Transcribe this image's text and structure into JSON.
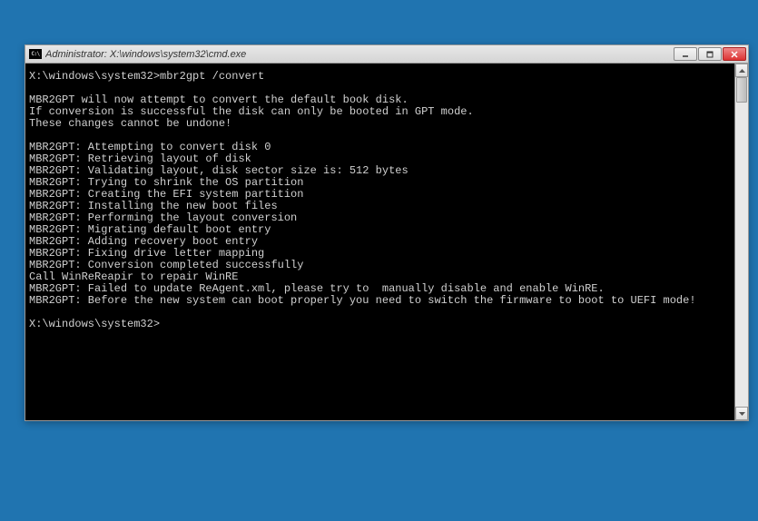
{
  "window": {
    "icon_text": "C:\\",
    "title": "Administrator: X:\\windows\\system32\\cmd.exe"
  },
  "terminal": {
    "lines": [
      "X:\\windows\\system32>mbr2gpt /convert",
      "",
      "MBR2GPT will now attempt to convert the default book disk.",
      "If conversion is successful the disk can only be booted in GPT mode.",
      "These changes cannot be undone!",
      "",
      "MBR2GPT: Attempting to convert disk 0",
      "MBR2GPT: Retrieving layout of disk",
      "MBR2GPT: Validating layout, disk sector size is: 512 bytes",
      "MBR2GPT: Trying to shrink the OS partition",
      "MBR2GPT: Creating the EFI system partition",
      "MBR2GPT: Installing the new boot files",
      "MBR2GPT: Performing the layout conversion",
      "MBR2GPT: Migrating default boot entry",
      "MBR2GPT: Adding recovery boot entry",
      "MBR2GPT: Fixing drive letter mapping",
      "MBR2GPT: Conversion completed successfully",
      "Call WinReReapir to repair WinRE",
      "MBR2GPT: Failed to update ReAgent.xml, please try to  manually disable and enable WinRE.",
      "MBR2GPT: Before the new system can boot properly you need to switch the firmware to boot to UEFI mode!",
      "",
      "X:\\windows\\system32>"
    ]
  }
}
